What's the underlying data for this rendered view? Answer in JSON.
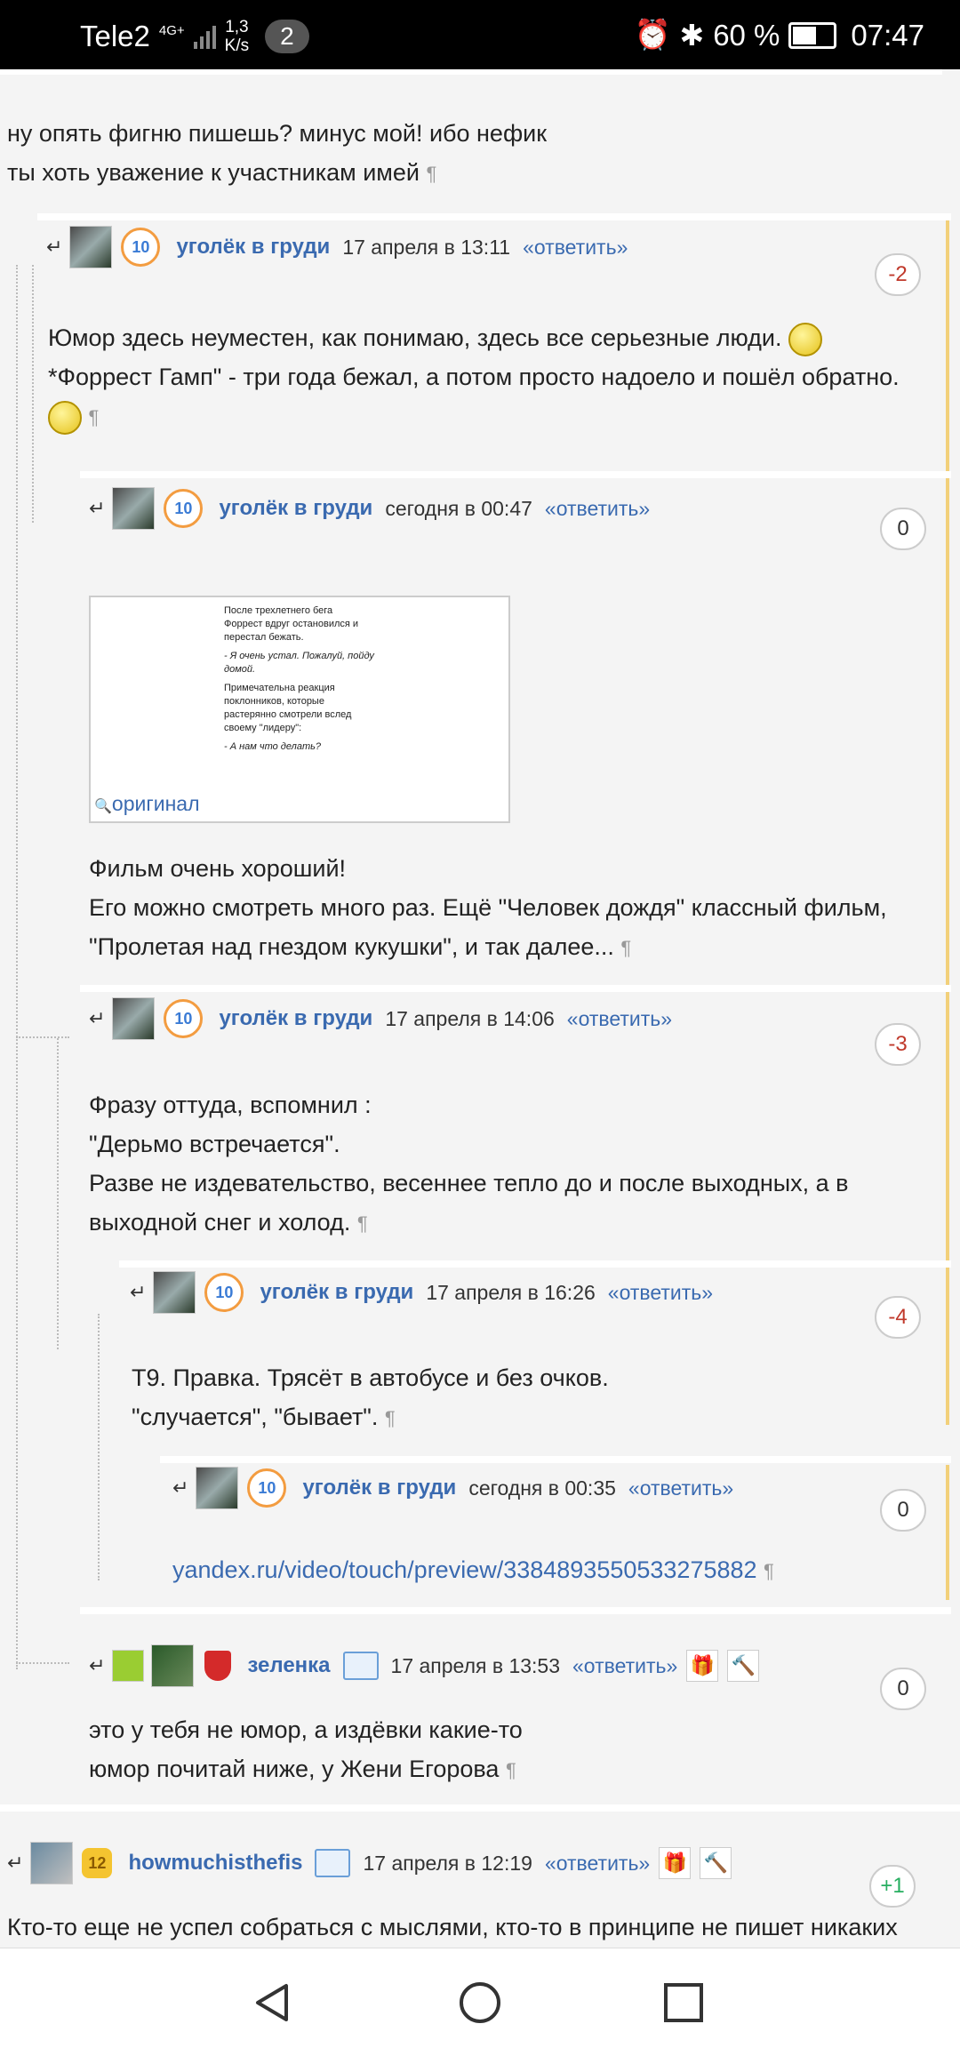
{
  "status_bar": {
    "carrier": "Tele2",
    "network": "4G+",
    "speed_top": "1,3",
    "speed_bottom": "K/s",
    "notif_count": "2",
    "battery": "60 %",
    "time": "07:47"
  },
  "comments": {
    "c0": {
      "line1": "ну опять фигню пишешь? минус мой! ибо нефик",
      "line2": "ты хоть уважение к участникам имей"
    },
    "c1": {
      "user": "уголёк в груди",
      "badge": "10",
      "date": "17 апреля в 13:11",
      "reply": "«ответить»",
      "score": "-2",
      "line1": "Юмор здесь неуместен, как понимаю, здесь все серьезные люди.",
      "line2": "*Форрест Гамп\" - три года бежал, а потом просто надоело и пошёл обратно."
    },
    "c2": {
      "user": "уголёк в груди",
      "badge": "10",
      "date": "сегодня в 00:47",
      "reply": "«ответить»",
      "score": "0",
      "image_lines": [
        "После трехлетнего бега",
        "Форрест вдруг остановился и",
        "перестал бежать.",
        "- Я очень устал. Пожалуй, пойду",
        "домой.",
        "Примечательна реакция",
        "поклонников, которые",
        "растерянно смотрели вслед",
        "своему \"лидеру\":",
        "- А нам что делать?"
      ],
      "original": "оригинал",
      "line1": "Фильм очень хороший!",
      "line2": "Его можно смотреть много раз. Ещё \"Человек дождя\" классный фильм,",
      "line3": "\"Пролетая над гнездом кукушки\", и так далее..."
    },
    "c3": {
      "user": "уголёк в груди",
      "badge": "10",
      "date": "17 апреля в 14:06",
      "reply": "«ответить»",
      "score": "-3",
      "line1": "Фразу оттуда, вспомнил :",
      "line2": "\"Дерьмо встречается\".",
      "line3": "Разве не издевательство, весеннее тепло до и после выходных, а в",
      "line4": "выходной снег и холод."
    },
    "c4": {
      "user": "уголёк в груди",
      "badge": "10",
      "date": "17 апреля в 16:26",
      "reply": "«ответить»",
      "score": "-4",
      "line1": "Т9. Правка. Трясёт в автобусе и без очков.",
      "line2": "\"случается\", \"бывает\"."
    },
    "c5": {
      "user": "уголёк в груди",
      "badge": "10",
      "date": "сегодня в 00:35",
      "reply": "«ответить»",
      "score": "0",
      "link": "yandex.ru/video/touch/preview/3384893550533275882"
    },
    "c6": {
      "user": "зеленка",
      "date": "17 апреля в 13:53",
      "reply": "«ответить»",
      "score": "0",
      "line1": "это у тебя не юмор, а издёвки какие-то",
      "line2": "юмор почитай ниже, у Жени Егорова"
    },
    "c7": {
      "user": "howmuchisthefis",
      "badge": "12",
      "date": "17 апреля в 12:19",
      "reply": "«ответить»",
      "score": "+1",
      "line1": "Кто-то еще не успел собраться с мыслями, кто-то в принципе не пишет никаких"
    }
  },
  "pilcrow": "¶",
  "colors": {
    "link": "#3a6ab0",
    "negative": "#c0392b",
    "positive": "#27ae60",
    "thread_line": "#f2d07a"
  }
}
